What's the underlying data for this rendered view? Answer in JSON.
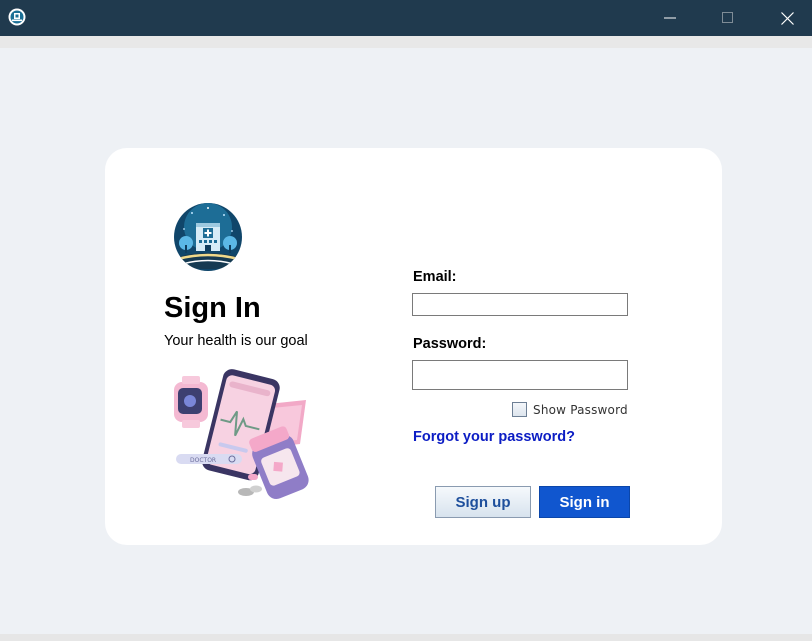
{
  "window": {
    "icon": "app-logo-icon",
    "controls": [
      "minimize-icon",
      "maximize-icon",
      "close-icon"
    ]
  },
  "brand": {
    "logo": "hospital-logo-icon",
    "illustration": "health-app-illustration",
    "illustration_text": "DOCTOR"
  },
  "header": {
    "title": "Sign In",
    "subtitle": "Your health is our goal"
  },
  "form": {
    "email_label": "Email:",
    "email_value": "",
    "password_label": "Password:",
    "password_value": "",
    "show_password_label": "Show Password",
    "show_password_checked": false,
    "forgot_link": "Forgot your password?",
    "signup_label": "Sign up",
    "signin_label": "Sign in"
  },
  "colors": {
    "titlebar": "#203a4e",
    "background": "#eef1f5",
    "card": "#ffffff",
    "primary_button": "#1056cf",
    "link": "#0c1dc4"
  }
}
